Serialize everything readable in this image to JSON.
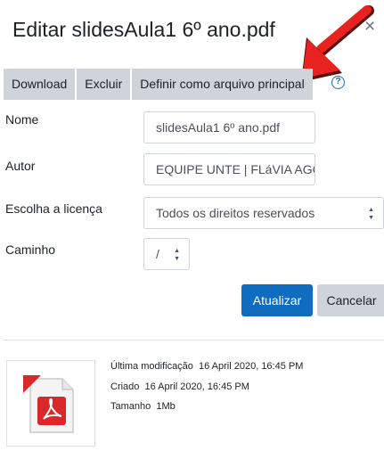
{
  "dialog": {
    "title": "Editar slidesAula1 6º ano.pdf",
    "close_glyph": "×"
  },
  "actions": {
    "download": "Download",
    "delete": "Excluir",
    "set_main": "Definir como arquivo principal",
    "help_glyph": "?"
  },
  "form": {
    "name_label": "Nome",
    "name_value": "slidesAula1 6º ano.pdf",
    "author_label": "Autor",
    "author_value": "EQUIPE UNTE | FLáVIA AGC",
    "license_label": "Escolha a licença",
    "license_value": "Todos os direitos reservados",
    "path_label": "Caminho",
    "path_value": "/"
  },
  "buttons": {
    "update": "Atualizar",
    "cancel": "Cancelar"
  },
  "file_info": {
    "modified_label": "Última modificação",
    "modified_value": "16 April 2020, 16:45 PM",
    "created_label": "Criado",
    "created_value": "16 April 2020, 16:45 PM",
    "size_label": "Tamanho",
    "size_value": "1Mb"
  },
  "colors": {
    "primary": "#0f6cbf",
    "button_gray": "#ced4da",
    "annotation_arrow": "#e8231f",
    "pdf_red": "#d8282a"
  },
  "icons": {
    "close": "close-icon",
    "help": "help-icon",
    "select": "sort-arrows-icon",
    "file": "pdf-file-icon",
    "annotation": "red-arrow-annotation"
  }
}
